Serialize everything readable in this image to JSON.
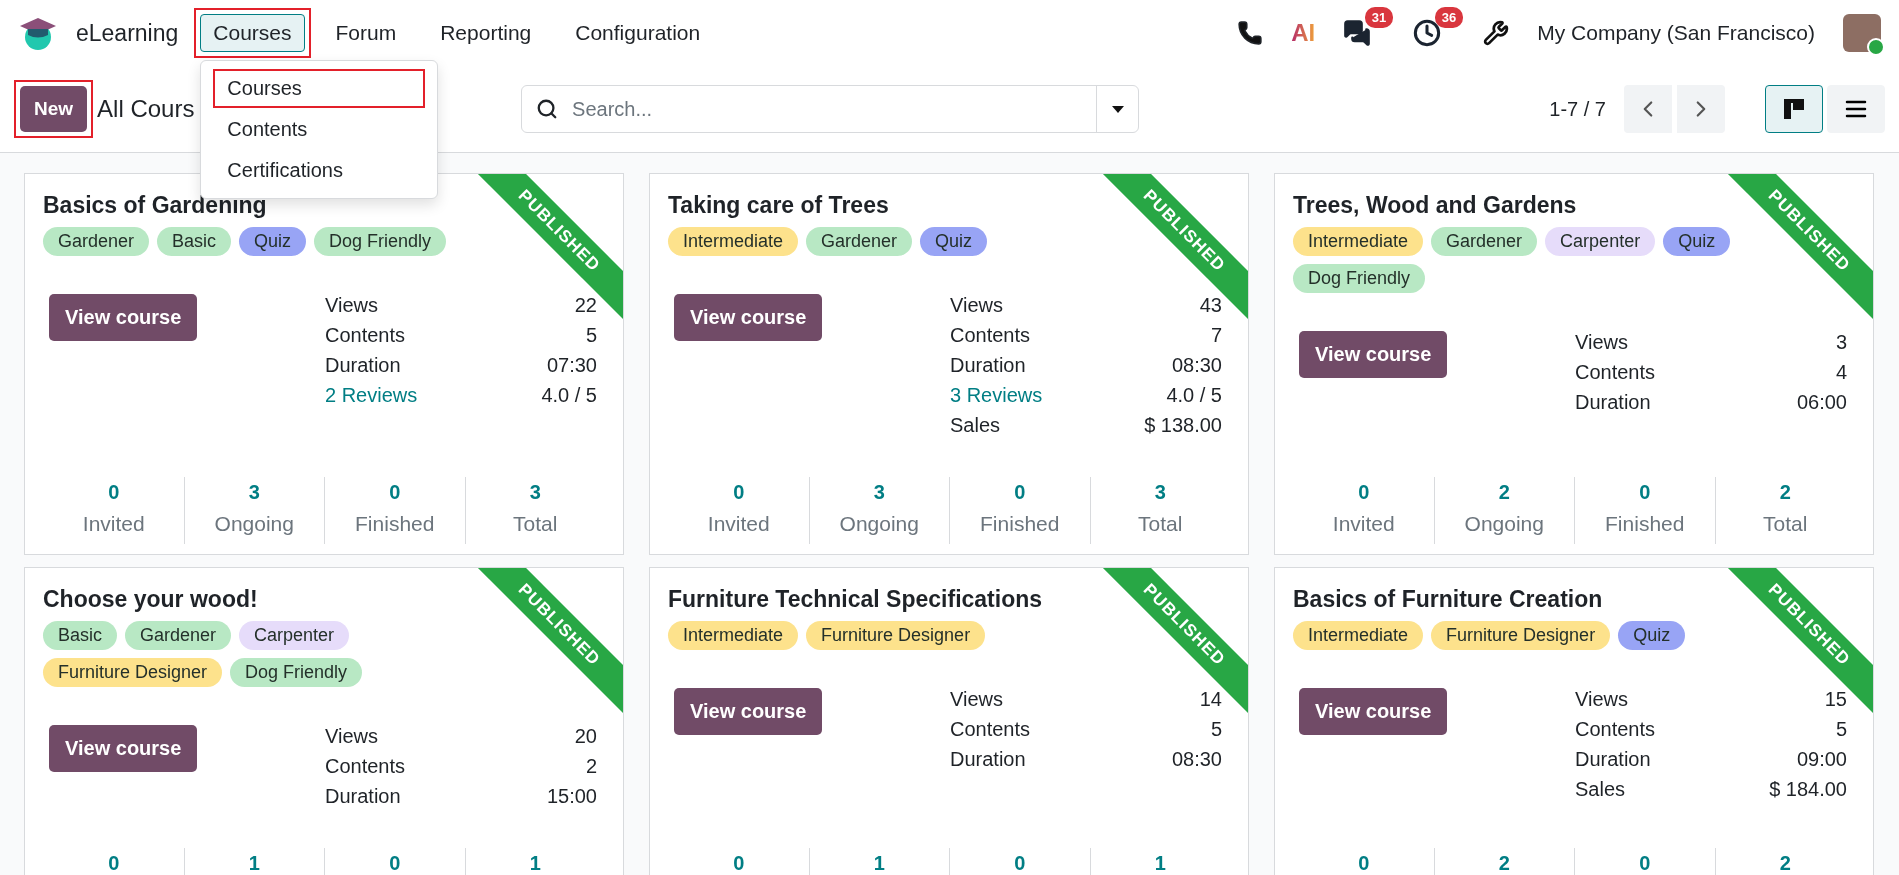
{
  "app": {
    "name": "eLearning"
  },
  "menu": [
    {
      "label": "Courses",
      "selected": true,
      "highlighted": true,
      "dropdown": [
        {
          "label": "Courses",
          "highlighted": true
        },
        {
          "label": "Contents",
          "highlighted": false
        },
        {
          "label": "Certifications",
          "highlighted": false
        }
      ]
    },
    {
      "label": "Forum",
      "selected": false,
      "highlighted": false
    },
    {
      "label": "Reporting",
      "selected": false,
      "highlighted": false
    },
    {
      "label": "Configuration",
      "selected": false,
      "highlighted": false
    }
  ],
  "systray": {
    "ai_label": "AI",
    "messages_badge": "31",
    "activities_badge": "36",
    "company": "My Company (San Francisco)",
    "user_online": true
  },
  "control_panel": {
    "new_button": {
      "label": "New",
      "highlighted": true
    },
    "title": "All Cours",
    "search": {
      "placeholder": "Search..."
    },
    "pager": "1-7 / 7",
    "views": [
      {
        "kind": "kanban",
        "selected": true
      },
      {
        "kind": "list",
        "selected": false
      }
    ]
  },
  "cards": [
    {
      "title": "Basics of Gardening",
      "ribbon": "PUBLISHED",
      "button": "View course",
      "tags": [
        {
          "label": "Gardener",
          "color": "#b8e8c4"
        },
        {
          "label": "Basic",
          "color": "#b8e8c4"
        },
        {
          "label": "Quiz",
          "color": "#98a4f5"
        },
        {
          "label": "Dog Friendly",
          "color": "#b8e8c4"
        }
      ],
      "stats": [
        {
          "label": "Views",
          "value": "22",
          "link": false
        },
        {
          "label": "Contents",
          "value": "5",
          "link": false
        },
        {
          "label": "Duration",
          "value": "07:30",
          "link": false
        },
        {
          "label": "2 Reviews",
          "value": "4.0 / 5",
          "link": true
        }
      ],
      "counters": [
        {
          "value": "0",
          "label": "Invited"
        },
        {
          "value": "3",
          "label": "Ongoing"
        },
        {
          "value": "0",
          "label": "Finished"
        },
        {
          "value": "3",
          "label": "Total"
        }
      ]
    },
    {
      "title": "Taking care of Trees",
      "ribbon": "PUBLISHED",
      "button": "View course",
      "tags": [
        {
          "label": "Intermediate",
          "color": "#fde28c"
        },
        {
          "label": "Gardener",
          "color": "#b8e8c4"
        },
        {
          "label": "Quiz",
          "color": "#98a4f5"
        }
      ],
      "stats": [
        {
          "label": "Views",
          "value": "43",
          "link": false
        },
        {
          "label": "Contents",
          "value": "7",
          "link": false
        },
        {
          "label": "Duration",
          "value": "08:30",
          "link": false
        },
        {
          "label": "3 Reviews",
          "value": "4.0 / 5",
          "link": true
        },
        {
          "label": "Sales",
          "value": "$ 138.00",
          "link": false
        }
      ],
      "counters": [
        {
          "value": "0",
          "label": "Invited"
        },
        {
          "value": "3",
          "label": "Ongoing"
        },
        {
          "value": "0",
          "label": "Finished"
        },
        {
          "value": "3",
          "label": "Total"
        }
      ]
    },
    {
      "title": "Trees, Wood and Gardens",
      "ribbon": "PUBLISHED",
      "button": "View course",
      "tags": [
        {
          "label": "Intermediate",
          "color": "#fde28c"
        },
        {
          "label": "Gardener",
          "color": "#b8e8c4"
        },
        {
          "label": "Carpenter",
          "color": "#e6dcfa"
        },
        {
          "label": "Quiz",
          "color": "#98a4f5"
        },
        {
          "label": "Dog Friendly",
          "color": "#b8e8c4"
        }
      ],
      "stats": [
        {
          "label": "Views",
          "value": "3",
          "link": false
        },
        {
          "label": "Contents",
          "value": "4",
          "link": false
        },
        {
          "label": "Duration",
          "value": "06:00",
          "link": false
        }
      ],
      "counters": [
        {
          "value": "0",
          "label": "Invited"
        },
        {
          "value": "2",
          "label": "Ongoing"
        },
        {
          "value": "0",
          "label": "Finished"
        },
        {
          "value": "2",
          "label": "Total"
        }
      ]
    },
    {
      "title": "Choose your wood!",
      "ribbon": "PUBLISHED",
      "button": "View course",
      "tags": [
        {
          "label": "Basic",
          "color": "#b8e8c4"
        },
        {
          "label": "Gardener",
          "color": "#b8e8c4"
        },
        {
          "label": "Carpenter",
          "color": "#e6dcfa"
        },
        {
          "label": "Furniture Designer",
          "color": "#fde28c"
        },
        {
          "label": "Dog Friendly",
          "color": "#b8e8c4"
        }
      ],
      "stats": [
        {
          "label": "Views",
          "value": "20",
          "link": false
        },
        {
          "label": "Contents",
          "value": "2",
          "link": false
        },
        {
          "label": "Duration",
          "value": "15:00",
          "link": false
        }
      ],
      "counters": [
        {
          "value": "0"
        },
        {
          "value": "1"
        },
        {
          "value": "0"
        },
        {
          "value": "1"
        }
      ]
    },
    {
      "title": "Furniture Technical Specifications",
      "ribbon": "PUBLISHED",
      "button": "View course",
      "tags": [
        {
          "label": "Intermediate",
          "color": "#fde28c"
        },
        {
          "label": "Furniture Designer",
          "color": "#fde28c"
        }
      ],
      "stats": [
        {
          "label": "Views",
          "value": "14",
          "link": false
        },
        {
          "label": "Contents",
          "value": "5",
          "link": false
        },
        {
          "label": "Duration",
          "value": "08:30",
          "link": false
        }
      ],
      "counters": [
        {
          "value": "0"
        },
        {
          "value": "1"
        },
        {
          "value": "0"
        },
        {
          "value": "1"
        }
      ]
    },
    {
      "title": "Basics of Furniture Creation",
      "ribbon": "PUBLISHED",
      "button": "View course",
      "tags": [
        {
          "label": "Intermediate",
          "color": "#fde28c"
        },
        {
          "label": "Furniture Designer",
          "color": "#fde28c"
        },
        {
          "label": "Quiz",
          "color": "#98a4f5"
        }
      ],
      "stats": [
        {
          "label": "Views",
          "value": "15",
          "link": false
        },
        {
          "label": "Contents",
          "value": "5",
          "link": false
        },
        {
          "label": "Duration",
          "value": "09:00",
          "link": false
        },
        {
          "label": "Sales",
          "value": "$ 184.00",
          "link": false
        }
      ],
      "counters": [
        {
          "value": "0"
        },
        {
          "value": "2"
        },
        {
          "value": "0"
        },
        {
          "value": "2"
        }
      ]
    }
  ]
}
